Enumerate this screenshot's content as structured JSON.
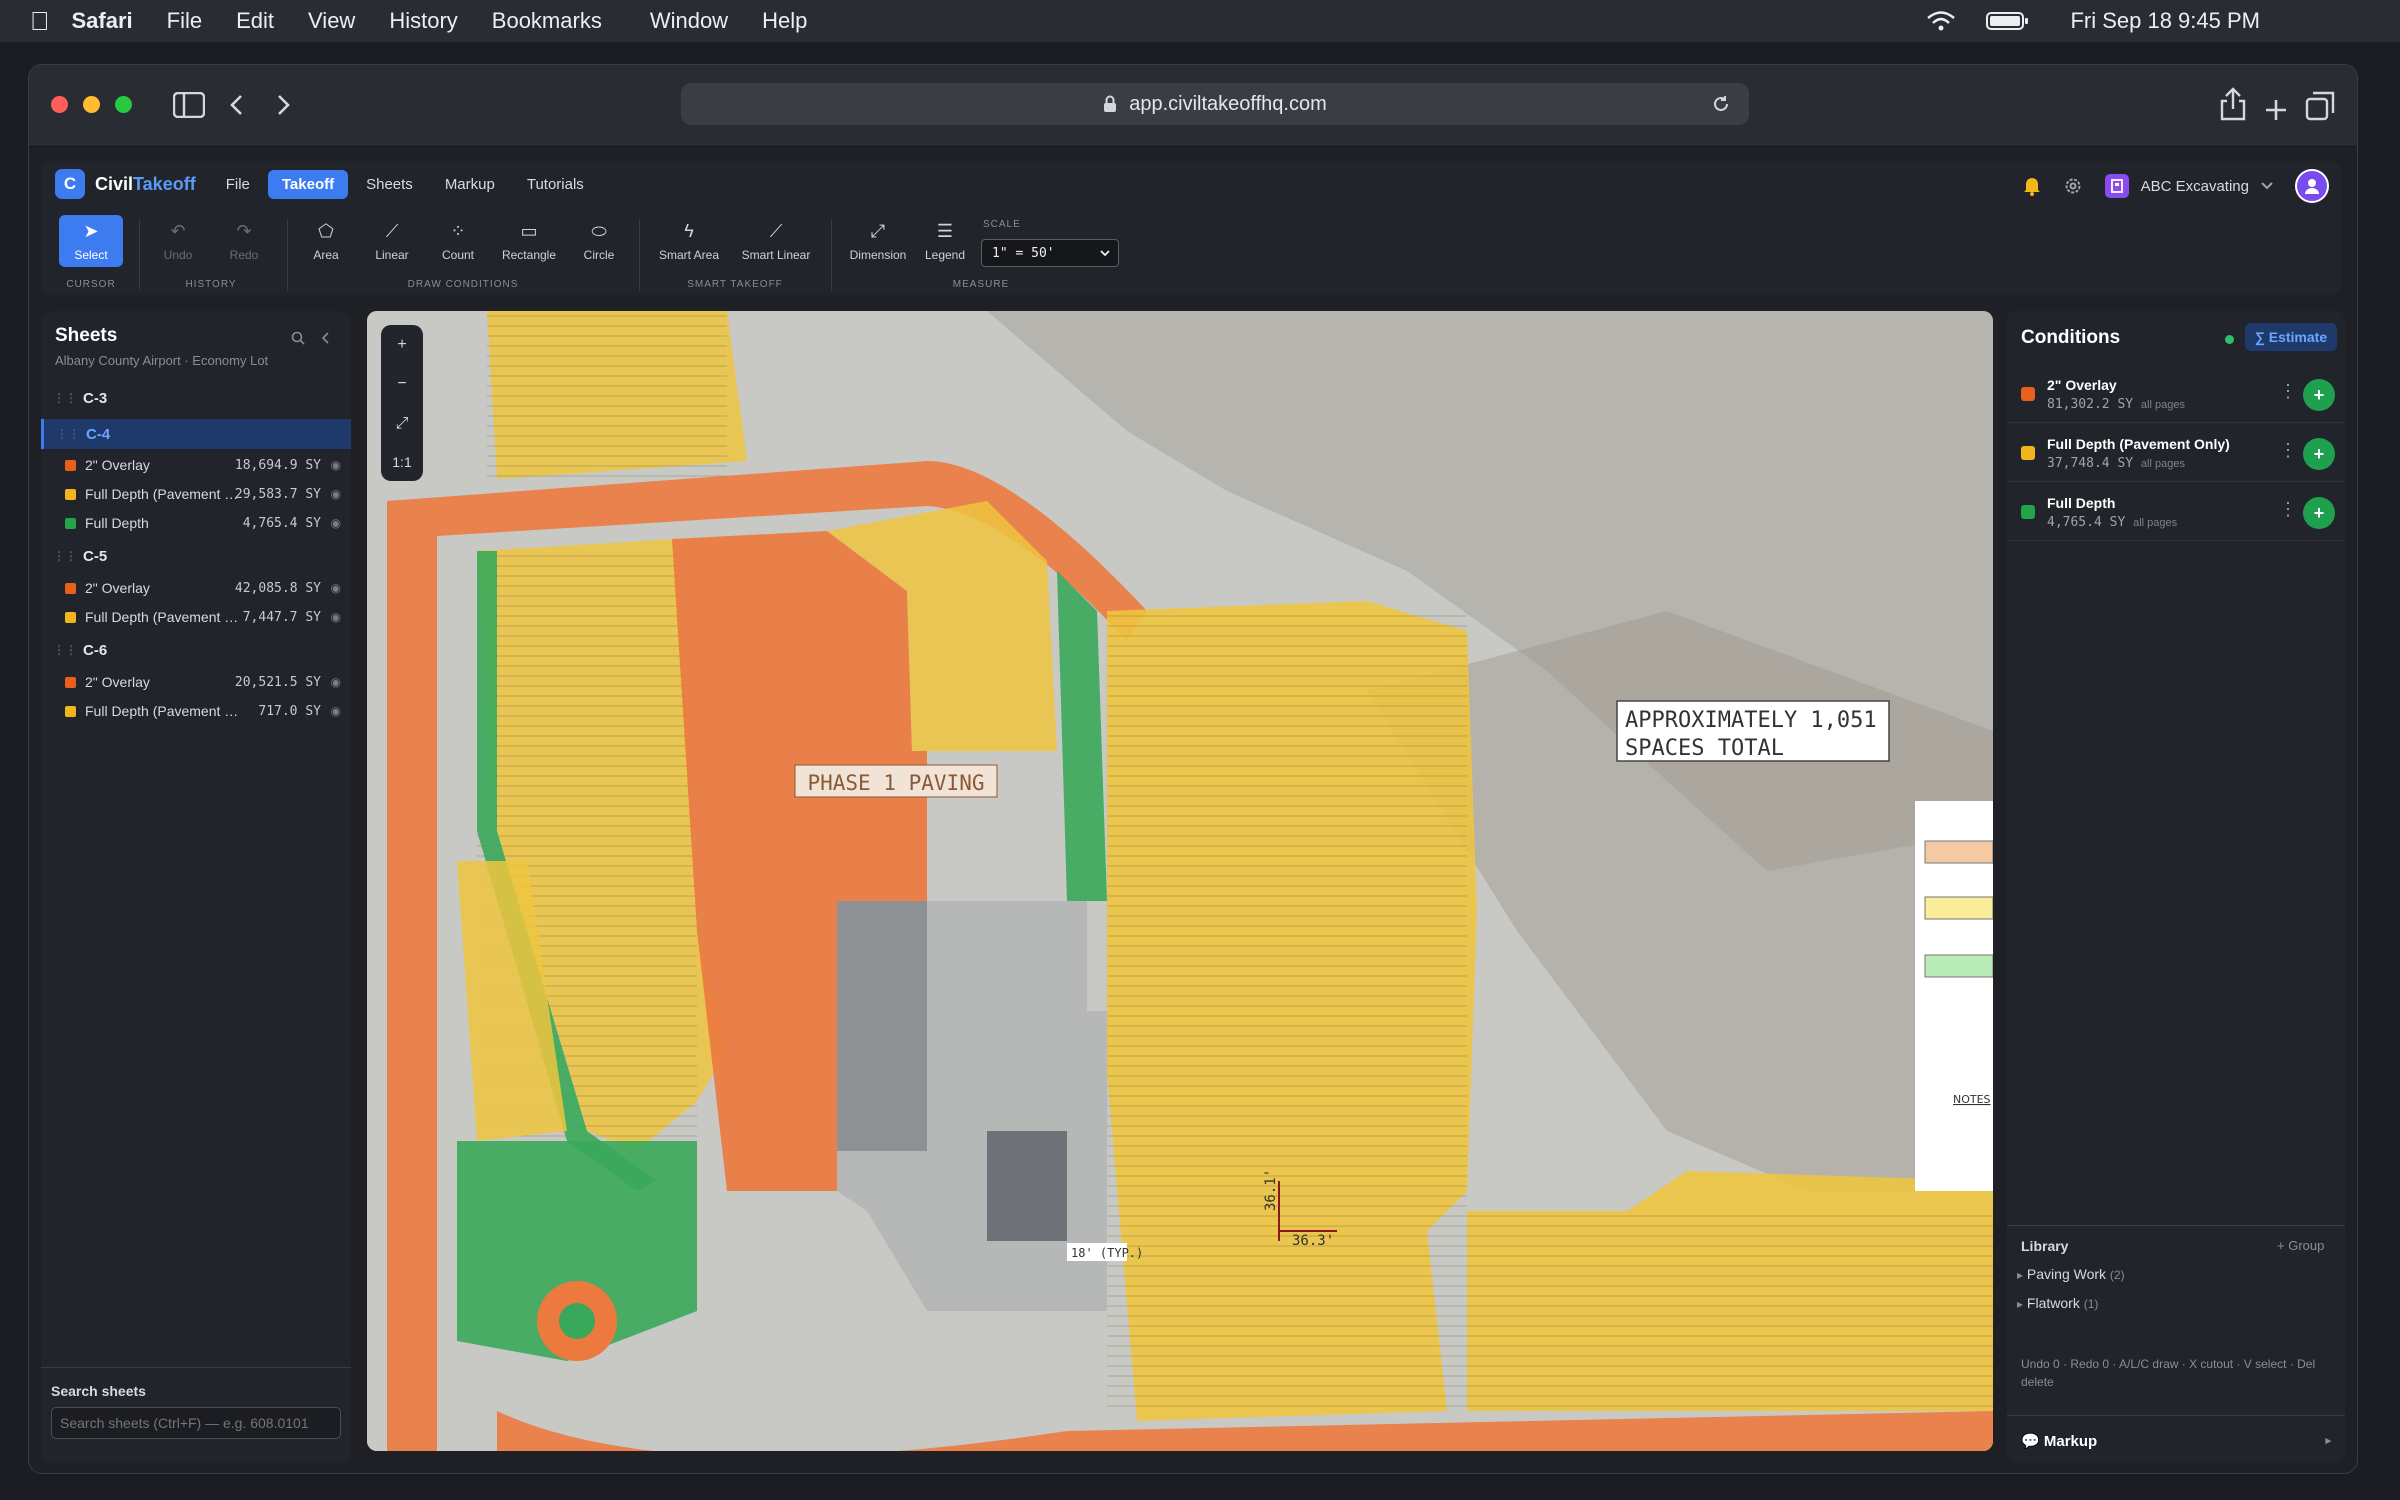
{
  "menubar": {
    "app_name": "Safari",
    "items": [
      "File",
      "Edit",
      "View",
      "History",
      "Bookmarks",
      "Window",
      "Help"
    ],
    "clock": "Fri Sep 18  9:45 PM"
  },
  "browser": {
    "url": "app.civiltakeoffhq.com"
  },
  "app": {
    "logo_letter": "C",
    "brand_main": "Civil",
    "brand_accent": "Takeoff",
    "nav": [
      "File",
      "Takeoff",
      "Sheets",
      "Markup",
      "Tutorials"
    ],
    "active_nav": "Takeoff",
    "company": "ABC Excavating"
  },
  "ribbon": {
    "tools": {
      "select": "Select",
      "undo": "Undo",
      "redo": "Redo",
      "area": "Area",
      "linear": "Linear",
      "count": "Count",
      "rectangle": "Rectangle",
      "circle": "Circle",
      "smart_area": "Smart Area",
      "smart_linear": "Smart Linear",
      "dimension": "Dimension",
      "legend": "Legend"
    },
    "groups": {
      "cursor": "CURSOR",
      "history": "HISTORY",
      "draw": "DRAW CONDITIONS",
      "smart": "SMART TAKEOFF",
      "measure": "MEASURE"
    },
    "scale_label": "SCALE",
    "scale_value": "1\" = 50'"
  },
  "sheets_panel": {
    "title": "Sheets",
    "project": "Albany County Airport · Economy Lot",
    "sheets": [
      {
        "name": "C-3",
        "conditions": []
      },
      {
        "name": "C-4",
        "conditions": [
          {
            "name": "2\" Overlay",
            "qty": "18,694.9 SY",
            "color": "#e8601c"
          },
          {
            "name": "Full Depth (Pavement Only)",
            "qty": "29,583.7 SY",
            "color": "#f2b51b"
          },
          {
            "name": "Full Depth",
            "qty": "4,765.4 SY",
            "color": "#22a34c"
          }
        ]
      },
      {
        "name": "C-5",
        "conditions": [
          {
            "name": "2\" Overlay",
            "qty": "42,085.8 SY",
            "color": "#e8601c"
          },
          {
            "name": "Full Depth (Pavement Only)",
            "qty": "7,447.7 SY",
            "color": "#f2b51b"
          }
        ]
      },
      {
        "name": "C-6",
        "conditions": [
          {
            "name": "2\" Overlay",
            "qty": "20,521.5 SY",
            "color": "#e8601c"
          },
          {
            "name": "Full Depth (Pavement Only)",
            "qty": "717.0 SY",
            "color": "#f2b51b"
          }
        ]
      }
    ],
    "active_sheet": "C-4",
    "search_label": "Search sheets",
    "search_placeholder": "Search sheets (Ctrl+F) — e.g. 608.0101"
  },
  "canvas": {
    "zoom_in": "+",
    "zoom_out": "−",
    "fit": "⤢",
    "reset": "1:1",
    "phase_label": "PHASE 1 PAVING",
    "spaces_line1": "APPROXIMATELY 1,051",
    "spaces_line2": "SPACES TOTAL",
    "dim_1": "36.1'",
    "dim_2": "36.3'",
    "typ_label": "18' (TYP.)",
    "notes_label": "NOTES"
  },
  "conditions_panel": {
    "title": "Conditions",
    "estimate_label": "∑ Estimate",
    "items": [
      {
        "name": "2\" Overlay",
        "qty": "81,302.2 SY",
        "scope": "all pages",
        "color": "#e8601c"
      },
      {
        "name": "Full Depth (Pavement Only)",
        "qty": "37,748.4 SY",
        "scope": "all pages",
        "color": "#f2b51b"
      },
      {
        "name": "Full Depth",
        "qty": "4,765.4 SY",
        "scope": "all pages",
        "color": "#22a34c"
      }
    ],
    "library_title": "Library",
    "library_group_button": "+ Group",
    "library_items": [
      {
        "name": "Paving Work",
        "count": "(2)"
      },
      {
        "name": "Flatwork",
        "count": "(1)"
      }
    ],
    "hint": "Undo 0 · Redo 0 · A/L/C draw · X cutout · V select · Del delete",
    "markup_label": "Markup"
  }
}
